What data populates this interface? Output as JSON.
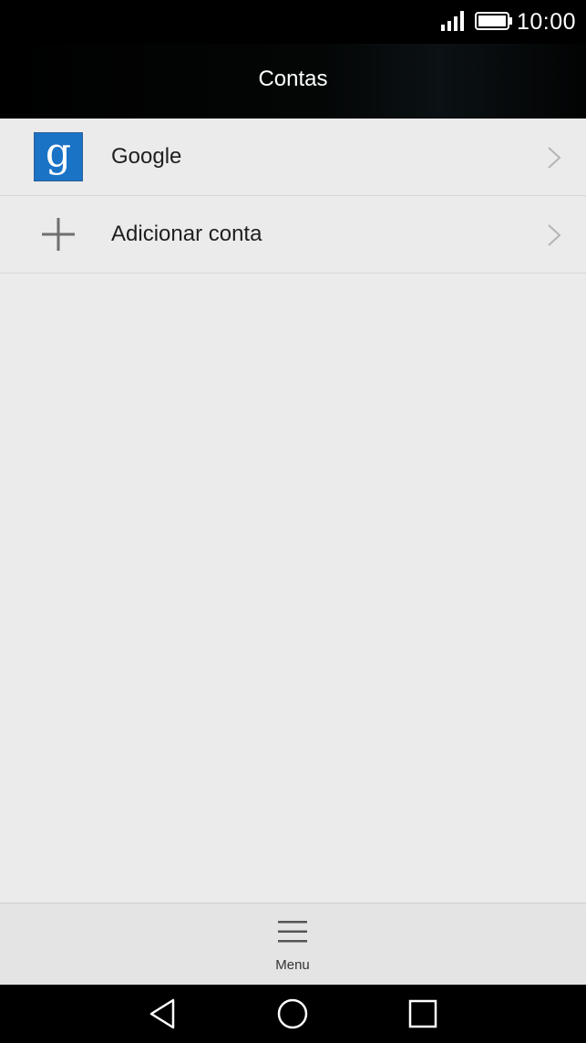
{
  "status_bar": {
    "time": "10:00",
    "signal_icon": "signal-icon",
    "battery_icon": "battery-full-icon"
  },
  "header": {
    "title": "Contas"
  },
  "accounts": [
    {
      "label": "Google",
      "icon": "google-icon"
    },
    {
      "label": "Adicionar conta",
      "icon": "plus-icon"
    }
  ],
  "bottom_bar": {
    "menu_label": "Menu",
    "menu_icon": "hamburger-menu-icon"
  },
  "nav_bar": {
    "back_icon": "back-triangle-icon",
    "home_icon": "home-circle-icon",
    "recents_icon": "recents-square-icon"
  },
  "colors": {
    "google_icon_bg": "#1b73c6",
    "background": "#ebebeb",
    "title_bar": "#000000"
  }
}
